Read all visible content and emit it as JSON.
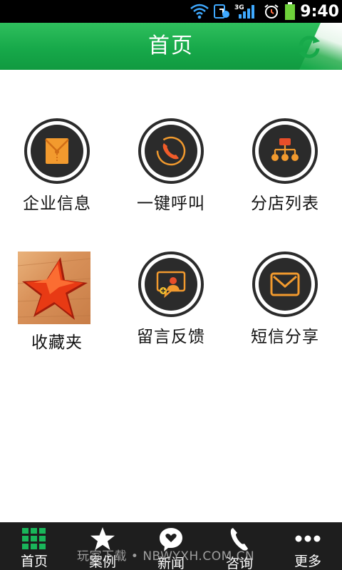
{
  "status_bar": {
    "network": "3G",
    "time": "9:40",
    "icons": [
      "wifi-icon",
      "sync-icon",
      "signal-icon",
      "alarm-icon",
      "battery-icon"
    ]
  },
  "header": {
    "title": "首页",
    "refresh_icon": "refresh-icon",
    "colors": {
      "bar": "#17a94a",
      "text": "#ffffff"
    }
  },
  "grid": [
    {
      "label": "企业信息",
      "icon": "envelope-icon"
    },
    {
      "label": "一键呼叫",
      "icon": "phone-icon"
    },
    {
      "label": "分店列表",
      "icon": "org-chart-icon"
    },
    {
      "label": "收藏夹",
      "icon": "star-image"
    },
    {
      "label": "留言反馈",
      "icon": "feedback-icon"
    },
    {
      "label": "短信分享",
      "icon": "mail-icon"
    }
  ],
  "icon_accent": "#f29a2e",
  "bottom_nav": [
    {
      "label": "首页",
      "icon": "grid-icon",
      "active": true
    },
    {
      "label": "案例",
      "icon": "star-icon"
    },
    {
      "label": "新闻",
      "icon": "chat-heart-icon"
    },
    {
      "label": "咨询",
      "icon": "phone-icon"
    },
    {
      "label": "更多",
      "icon": "more-dots-icon"
    }
  ],
  "watermark": "玩家下载 • NBWYXH.COM.CN"
}
